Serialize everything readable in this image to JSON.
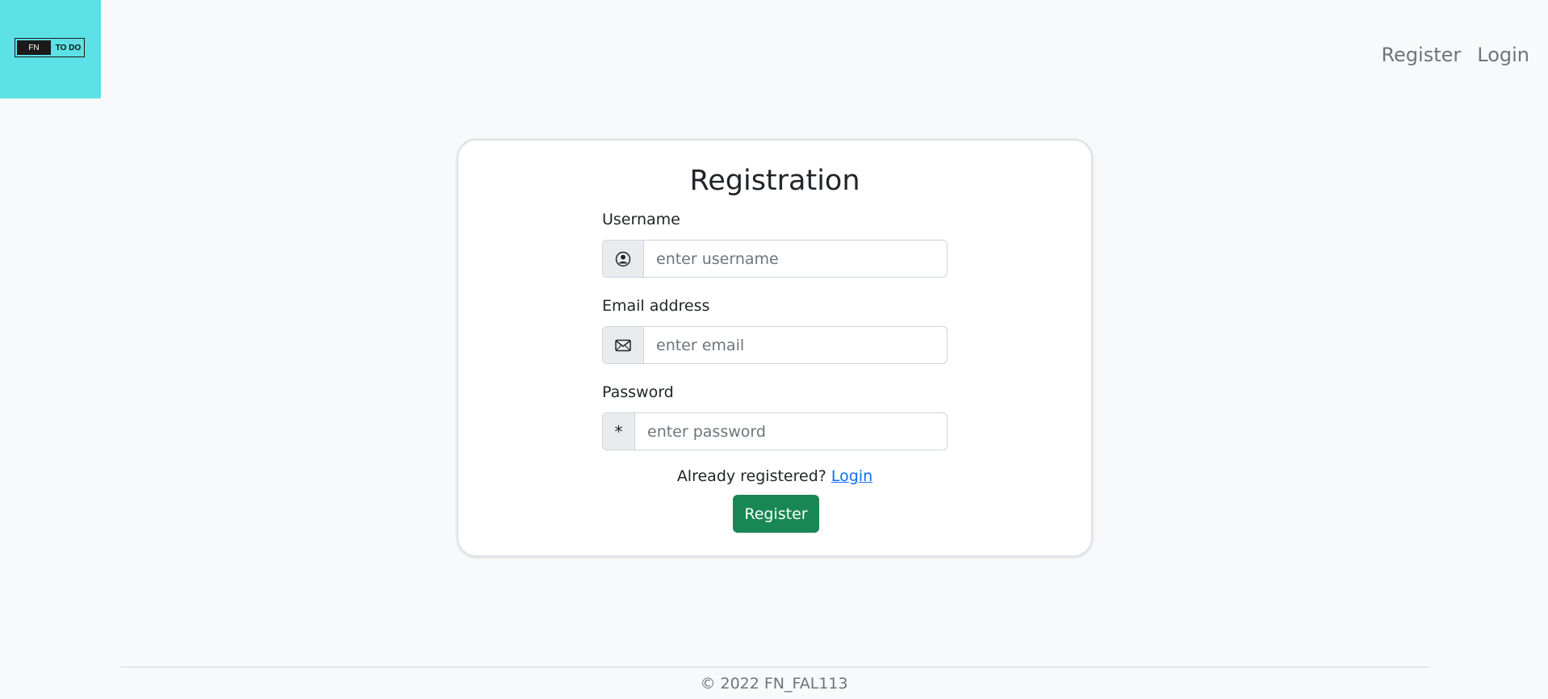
{
  "logo": {
    "left": "FN",
    "right": "TO DO"
  },
  "nav": {
    "register": "Register",
    "login": "Login"
  },
  "form": {
    "title": "Registration",
    "username": {
      "label": "Username",
      "placeholder": "enter username",
      "icon": "person-circle-icon"
    },
    "email": {
      "label": "Email address",
      "placeholder": "enter email",
      "icon": "envelope-icon"
    },
    "password": {
      "label": "Password",
      "placeholder": "enter password",
      "addon": "*"
    },
    "already_text": "Already registered?",
    "login_link": "Login",
    "submit_label": "Register"
  },
  "footer": {
    "copyright": "© 2022 FN_FAL113"
  },
  "colors": {
    "accent_teal": "#5ce1e6",
    "submit_green": "#198754",
    "link_blue": "#0d6efd"
  }
}
